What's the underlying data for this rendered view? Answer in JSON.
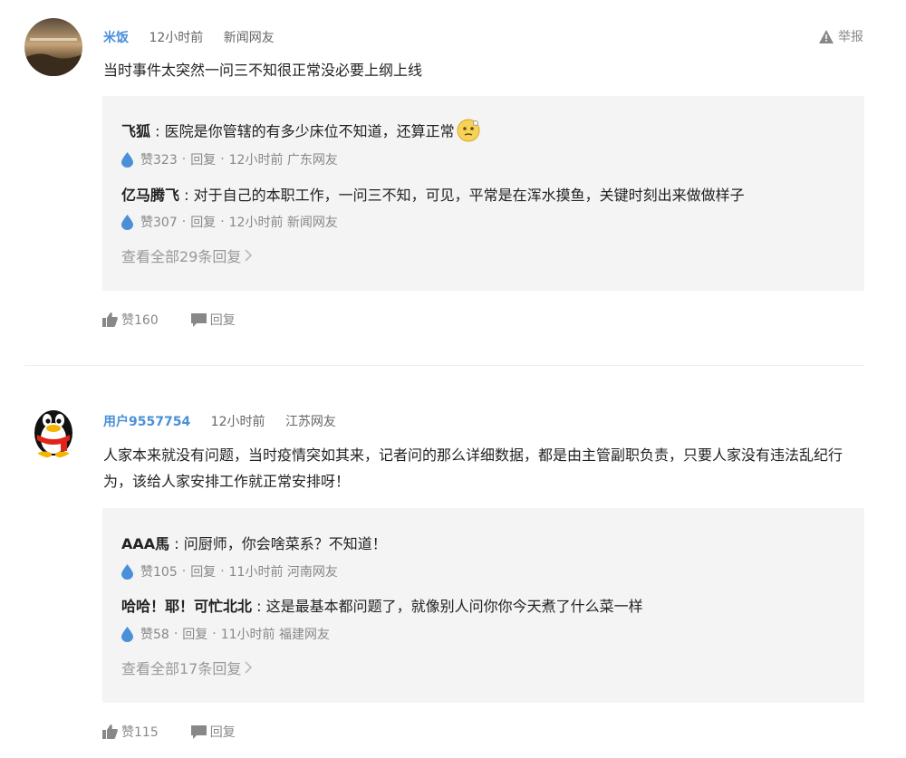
{
  "comments": [
    {
      "username": "米饭",
      "time": "12小时前",
      "location": "新闻网友",
      "report_label": "举报",
      "text": "当时事件太突然一问三不知很正常没必要上纲上线",
      "avatar_icon": "landscape-photo-avatar",
      "replies": [
        {
          "name": "飞狐",
          "text": "医院是你管辖的有多少床位不知道，还算正常",
          "emoji": "thinking-face-emoji",
          "likes": "赞323",
          "reply_label": "回复",
          "time": "12小时前",
          "location": "广东网友"
        },
        {
          "name": "亿马腾飞",
          "text": "对于自己的本职工作，一问三不知，可见，平常是在浑水摸鱼，关键时刻出来做做样子",
          "likes": "赞307",
          "reply_label": "回复",
          "time": "12小时前",
          "location": "新闻网友"
        }
      ],
      "view_all": "查看全部29条回复",
      "likes": "赞160",
      "reply_label": "回复"
    },
    {
      "username": "用户9557754",
      "time": "12小时前",
      "location": "江苏网友",
      "text": "人家本来就没有问题，当时疫情突如其来，记者问的那么详细数据，都是由主管副职负责，只要人家没有违法乱纪行为，该给人家安排工作就正常安排呀！",
      "avatar_icon": "qq-penguin-avatar",
      "replies": [
        {
          "name": "AAA馬",
          "text": "问厨师，你会啥菜系？不知道！",
          "likes": "赞105",
          "reply_label": "回复",
          "time": "11小时前",
          "location": "河南网友"
        },
        {
          "name": "哈哈！耶！可忙北北",
          "text": "这是最基本都问题了，就像别人问你你今天煮了什么菜一样",
          "likes": "赞58",
          "reply_label": "回复",
          "time": "11小时前",
          "location": "福建网友"
        }
      ],
      "view_all": "查看全部17条回复",
      "likes": "赞115",
      "reply_label": "回复"
    }
  ],
  "colors": {
    "username": "#4a90d9",
    "reply_bg": "#f4f4f4",
    "drop_icon": "#4a90d9",
    "meta_text": "#888888"
  }
}
